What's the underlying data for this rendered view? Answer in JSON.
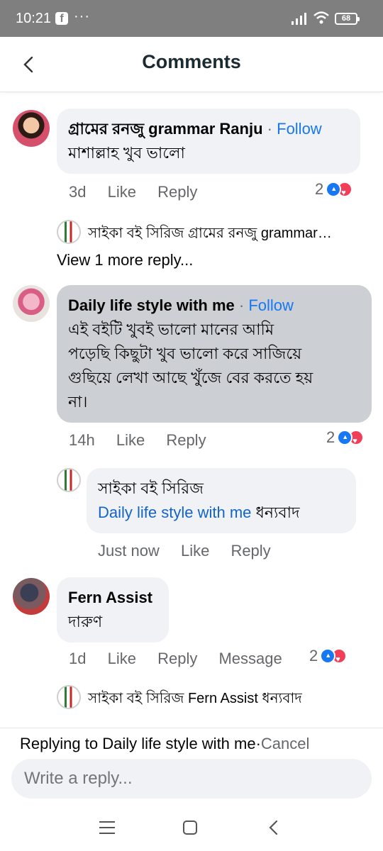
{
  "status_bar": {
    "time": "10:21",
    "app_icon": "facebook-icon",
    "overflow": "···",
    "battery": "68"
  },
  "header": {
    "title": "Comments",
    "back_icon": "chevron-left-icon"
  },
  "comments": [
    {
      "author": "গ্রামের রনজু grammar Ranju",
      "follow": "Follow",
      "text": "মাশাল্লাহ খুব ভালো",
      "time": "3d",
      "like": "Like",
      "reply": "Reply",
      "reaction_count": "2",
      "reply_preview": "সাইকা বই সিরিজ গ্রামের রনজু grammar…",
      "view_more": "View 1 more reply..."
    },
    {
      "author": "Daily life style with me",
      "follow": "Follow",
      "text_lines": [
        "এই বইটি খুবই ভালো মানের আমি",
        "পড়েছি কিছুটা খুব ভালো করে সাজিয়ে",
        "গুছিয়ে লেখা আছে খুঁজে বের করতে হয়",
        "না।"
      ],
      "time": "14h",
      "like": "Like",
      "reply": "Reply",
      "reaction_count": "2",
      "nested_reply": {
        "author": "সাইকা বই সিরিজ",
        "mention": "Daily life style with me",
        "text": "ধন্যবাদ",
        "time": "Just now",
        "like": "Like",
        "reply": "Reply"
      }
    },
    {
      "author": "Fern Assist",
      "text": "দারুণ",
      "time": "1d",
      "like": "Like",
      "reply": "Reply",
      "message": "Message",
      "reaction_count": "2",
      "reply_preview": "সাইকা বই সিরিজ Fern Assist ধন্যবাদ"
    }
  ],
  "composer": {
    "replying_prefix": "Replying to",
    "replying_to": "Daily life style with me",
    "separator": "·",
    "cancel": "Cancel",
    "placeholder": "Write a reply..."
  },
  "colors": {
    "accent": "#1877f2",
    "bubble": "#f0f2f5",
    "selected_bubble": "#ccd0d5",
    "muted": "#65676b"
  }
}
